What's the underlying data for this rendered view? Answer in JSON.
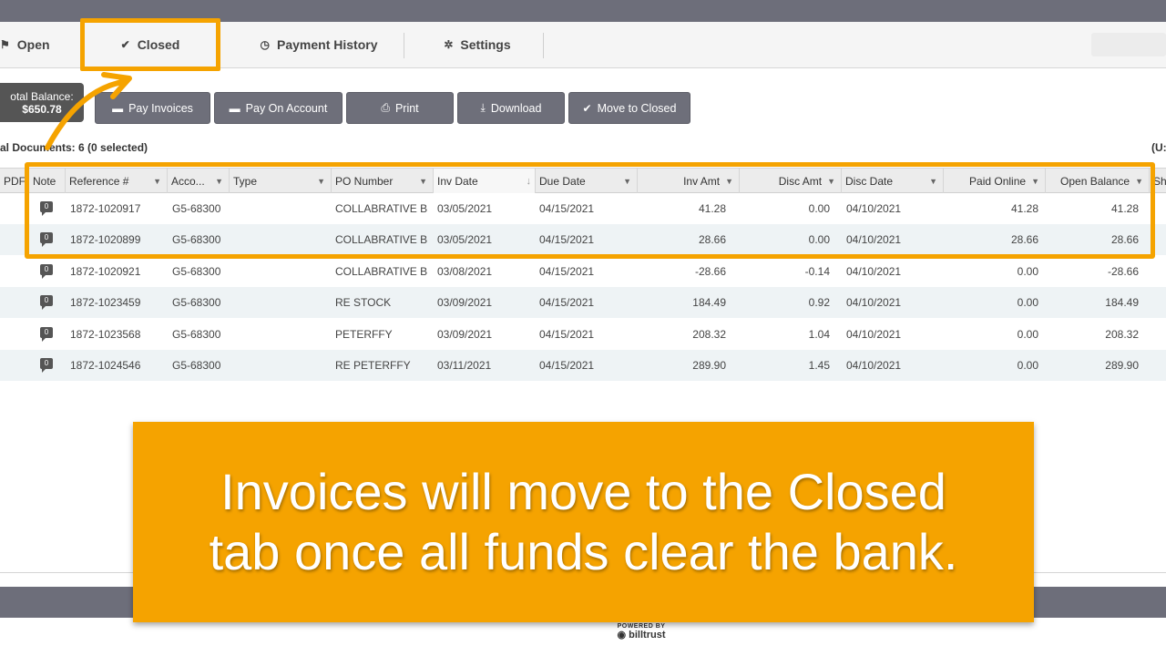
{
  "tabs": {
    "open": "Open",
    "closed": "Closed",
    "payment_history": "Payment History",
    "settings": "Settings"
  },
  "balance": {
    "label": "otal Balance:",
    "amount": "$650.78"
  },
  "toolbar": {
    "pay_invoices": "Pay Invoices",
    "pay_on_account": "Pay On Account",
    "print": "Print",
    "download": "Download",
    "move_to_closed": "Move to Closed"
  },
  "documents_label": "al Documents: 6 (0 selected)",
  "currency_label": "(U:",
  "columns": {
    "pdf": "PDF",
    "note": "Note",
    "reference": "Reference #",
    "account": "Acco...",
    "type": "Type",
    "po_number": "PO Number",
    "inv_date": "Inv Date",
    "due_date": "Due Date",
    "inv_amt": "Inv Amt",
    "disc_amt": "Disc Amt",
    "disc_date": "Disc Date",
    "paid_online": "Paid Online",
    "open_balance": "Open Balance",
    "sh": "Sh"
  },
  "rows": [
    {
      "ref": "1872-1020917",
      "acct": "G5-68300",
      "type": "",
      "po": "COLLABRATIVE B",
      "inv_date": "03/05/2021",
      "due_date": "04/15/2021",
      "inv_amt": "41.28",
      "disc_amt": "0.00",
      "disc_date": "04/10/2021",
      "paid_online": "41.28",
      "open_balance": "41.28"
    },
    {
      "ref": "1872-1020899",
      "acct": "G5-68300",
      "type": "",
      "po": "COLLABRATIVE B",
      "inv_date": "03/05/2021",
      "due_date": "04/15/2021",
      "inv_amt": "28.66",
      "disc_amt": "0.00",
      "disc_date": "04/10/2021",
      "paid_online": "28.66",
      "open_balance": "28.66"
    },
    {
      "ref": "1872-1020921",
      "acct": "G5-68300",
      "type": "",
      "po": "COLLABRATIVE B",
      "inv_date": "03/08/2021",
      "due_date": "04/15/2021",
      "inv_amt": "-28.66",
      "disc_amt": "-0.14",
      "disc_date": "04/10/2021",
      "paid_online": "0.00",
      "open_balance": "-28.66"
    },
    {
      "ref": "1872-1023459",
      "acct": "G5-68300",
      "type": "",
      "po": "RE STOCK",
      "inv_date": "03/09/2021",
      "due_date": "04/15/2021",
      "inv_amt": "184.49",
      "disc_amt": "0.92",
      "disc_date": "04/10/2021",
      "paid_online": "0.00",
      "open_balance": "184.49"
    },
    {
      "ref": "1872-1023568",
      "acct": "G5-68300",
      "type": "",
      "po": "PETERFFY",
      "inv_date": "03/09/2021",
      "due_date": "04/15/2021",
      "inv_amt": "208.32",
      "disc_amt": "1.04",
      "disc_date": "04/10/2021",
      "paid_online": "0.00",
      "open_balance": "208.32"
    },
    {
      "ref": "1872-1024546",
      "acct": "G5-68300",
      "type": "",
      "po": "RE PETERFFY",
      "inv_date": "03/11/2021",
      "due_date": "04/15/2021",
      "inv_amt": "289.90",
      "disc_amt": "1.45",
      "disc_date": "04/10/2021",
      "paid_online": "0.00",
      "open_balance": "289.90"
    }
  ],
  "callout": {
    "line1": "Invoices will move to the Closed",
    "line2": "tab once all funds clear the bank."
  },
  "powered_by": {
    "label": "POWERED BY",
    "brand": "billtrust"
  },
  "colors": {
    "accent": "#f5a300",
    "bar": "#6d6e7a",
    "button": "#6e6f7a"
  }
}
